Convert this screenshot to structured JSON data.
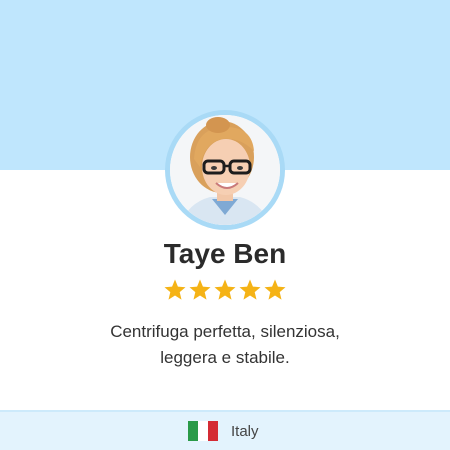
{
  "colors": {
    "top_band": "#bfe6fd",
    "avatar_ring": "#a9daf6",
    "star": "#f5b316",
    "footer_bg": "#e3f3fd",
    "flag": [
      "#2a9a48",
      "#ffffff",
      "#d42b34"
    ]
  },
  "reviewer": {
    "name": "Taye Ben",
    "avatar_icon": "reviewer-photo",
    "rating": 5,
    "rating_max": 5
  },
  "review": {
    "text": "Centrifuga perfetta, silenziosa,\nleggera e stabile."
  },
  "footer": {
    "flag_icon": "italy-flag-icon",
    "country": "Italy"
  }
}
